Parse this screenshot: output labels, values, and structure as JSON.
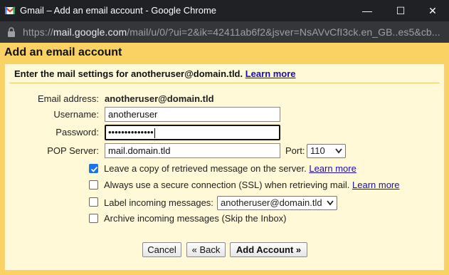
{
  "window": {
    "title": "Gmail – Add an email account - Google Chrome",
    "minimize": "—",
    "maximize": "☐",
    "close": "✕"
  },
  "browser": {
    "url_scheme": "https://",
    "url_host": "mail.google.com",
    "url_path": "/mail/u/0/?ui=2&ik=42411ab6f2&jsver=NsAVvCfI3ck.en_GB..es5&cb..."
  },
  "dialog": {
    "heading": "Add an email account",
    "intro": "Enter the mail settings for anotheruser@domain.tld.",
    "intro_link": "Learn more"
  },
  "form": {
    "email_label": "Email address:",
    "email_value": "anotheruser@domain.tld",
    "username_label": "Username:",
    "username_value": "anotheruser",
    "password_label": "Password:",
    "password_value": "••••••••••••••",
    "pop_server_label": "POP Server:",
    "pop_server_value": "mail.domain.tld",
    "port_label": "Port:",
    "port_value": "110",
    "options": [
      {
        "label": "Leave a copy of retrieved message on the server.",
        "link": "Learn more",
        "checked": true
      },
      {
        "label": "Always use a secure connection (SSL) when retrieving mail.",
        "link": "Learn more",
        "checked": false
      },
      {
        "label": "Label incoming messages:",
        "select_value": "anotheruser@domain.tld",
        "checked": false
      },
      {
        "label": "Archive incoming messages (Skip the Inbox)",
        "checked": false
      }
    ]
  },
  "buttons": {
    "cancel": "Cancel",
    "back": "« Back",
    "add_account": "Add Account »"
  },
  "colors": {
    "panel_yellow": "#fad163",
    "content_bg": "#fff9d8",
    "link_blue": "#1a0dab",
    "checkbox_blue": "#1a73e8",
    "titlebar": "#202124"
  }
}
